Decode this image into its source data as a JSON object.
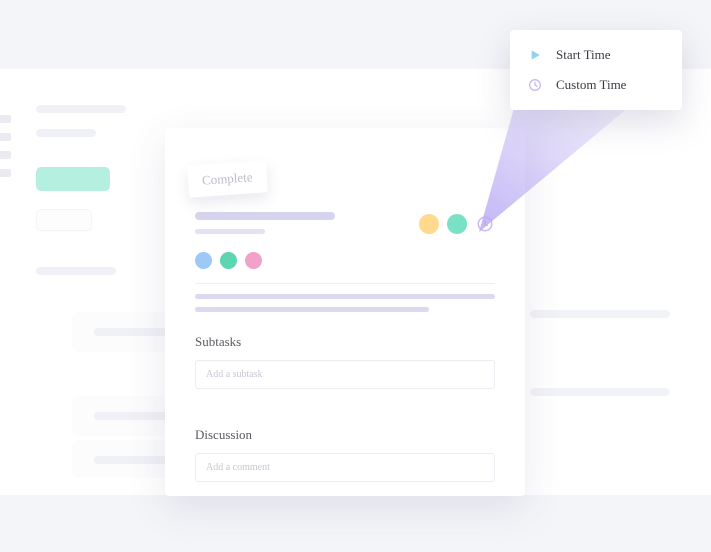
{
  "card": {
    "complete_label": "Complete",
    "subtasks_heading": "Subtasks",
    "subtask_placeholder": "Add a subtask",
    "discussion_heading": "Discussion",
    "comment_placeholder": "Add a comment"
  },
  "popup": {
    "start_label": "Start Time",
    "custom_label": "Custom Time"
  },
  "colors": {
    "beam": "#b7a8f3",
    "play_icon": "#8fd2f4",
    "clock_icon": "#c9b8f2"
  }
}
